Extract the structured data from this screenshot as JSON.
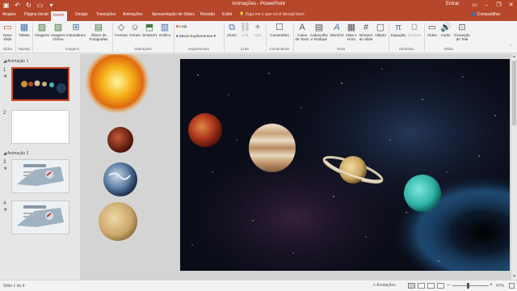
{
  "app": {
    "title": "Animações - PowerPoint",
    "account": "Entrar",
    "share": "Compartilhar",
    "tell_me": "Diga-me o que você deseja fazer"
  },
  "tabs": [
    "Arquivo",
    "Página Inicial",
    "Inserir",
    "Design",
    "Transições",
    "Animações",
    "Apresentação de Slides",
    "Revisão",
    "Exibir"
  ],
  "active_tab": "Inserir",
  "ribbon": {
    "buttons": {
      "new_slide": "Novo Slide",
      "table": "Tabela",
      "images": "Imagens",
      "online_images": "Imagens Online",
      "screenshot": "Instantâneo",
      "album": "Álbum de Fotografias",
      "shapes": "Formas",
      "icons": "Ícones",
      "smartart": "SmartArt",
      "chart": "Gráfico",
      "store": "Loja",
      "my_addins": "Meus Suplementos",
      "zoom": "Zoom",
      "link": "Link",
      "action": "Ação",
      "comment": "Comentário",
      "textbox": "Caixa de Texto",
      "header_footer": "Cabeçalho e Rodapé",
      "wordart": "WordArt",
      "datetime": "Data e Hora",
      "slide_number": "Número do Slide",
      "object": "Objeto",
      "equation": "Equação",
      "symbol": "Símbolo",
      "video": "Vídeo",
      "audio": "Áudio",
      "screen_recording": "Gravação de Tela"
    },
    "groups": {
      "slides": "Slides",
      "tables": "Tabelas",
      "images": "Imagens",
      "illustrations": "Ilustrações",
      "addins": "Suplementos",
      "links": "Links",
      "comments": "Comentários",
      "text": "Texto",
      "symbols": "Símbolos",
      "media": "Mídia"
    }
  },
  "slide_panel": {
    "sections": [
      "Animação 1",
      "Animação 2"
    ],
    "slides": [
      {
        "number": "1",
        "section": "Animação 1",
        "selected": true
      },
      {
        "number": "2",
        "section": "Animação 1",
        "selected": false
      },
      {
        "number": "3",
        "section": "Animação 2",
        "selected": false
      },
      {
        "number": "4",
        "section": "Animação 2",
        "selected": false
      }
    ]
  },
  "status": {
    "slide_counter": "Slide 1 de 4",
    "notes": "Anotações",
    "zoom": "47%"
  },
  "colors": {
    "accent": "#b7472a",
    "ribbon_bg": "#f3f3f3",
    "selection": "#d24726"
  }
}
